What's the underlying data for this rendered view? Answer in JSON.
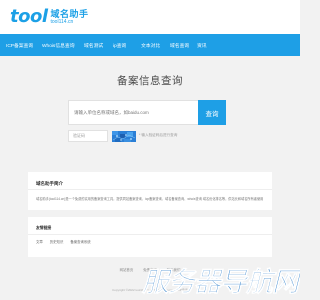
{
  "header": {
    "logo_mark": "tool",
    "logo_cn": "域名助手",
    "logo_domain": "tool114.cn"
  },
  "nav": {
    "items": [
      {
        "label": "ICP备案查询"
      },
      {
        "label": "Whois信息查询"
      },
      {
        "label": "域名测试"
      },
      {
        "label": "ip查询"
      },
      {
        "label": "文本对比"
      },
      {
        "label": "域名查询"
      },
      {
        "label": "资讯"
      }
    ]
  },
  "search": {
    "title": "备案信息查询",
    "placeholder": "请输入单位名称或域名，如baidu.com",
    "button_label": "查询",
    "captcha_placeholder": "验证码",
    "captcha_hint": "* 输入验证码后进行查询"
  },
  "intro": {
    "title": "域名助手简介",
    "text": "域名助手(tool114.cn)是一个免费的实用的备案查询工具，提供同站备案查询、icp备案查询、域名备案查询、whois查询 域名优化排名等，供站长和域名所有者使用"
  },
  "links": {
    "title": "友情链接",
    "items": [
      {
        "label": "文章"
      },
      {
        "label": "历史知识"
      },
      {
        "label": "备案查询系统"
      }
    ]
  },
  "footer": {
    "links": [
      {
        "label": "网站首页"
      },
      {
        "label": "免责声明"
      },
      {
        "label": "联系我们"
      }
    ],
    "copyright": "Copyright ©2022 tool114.cn All Rights Reserved ICP备案"
  },
  "watermark": {
    "text": "服务器导航网"
  },
  "colors": {
    "brand_blue": "#1e9fe6",
    "background": "#f2f2f2"
  }
}
